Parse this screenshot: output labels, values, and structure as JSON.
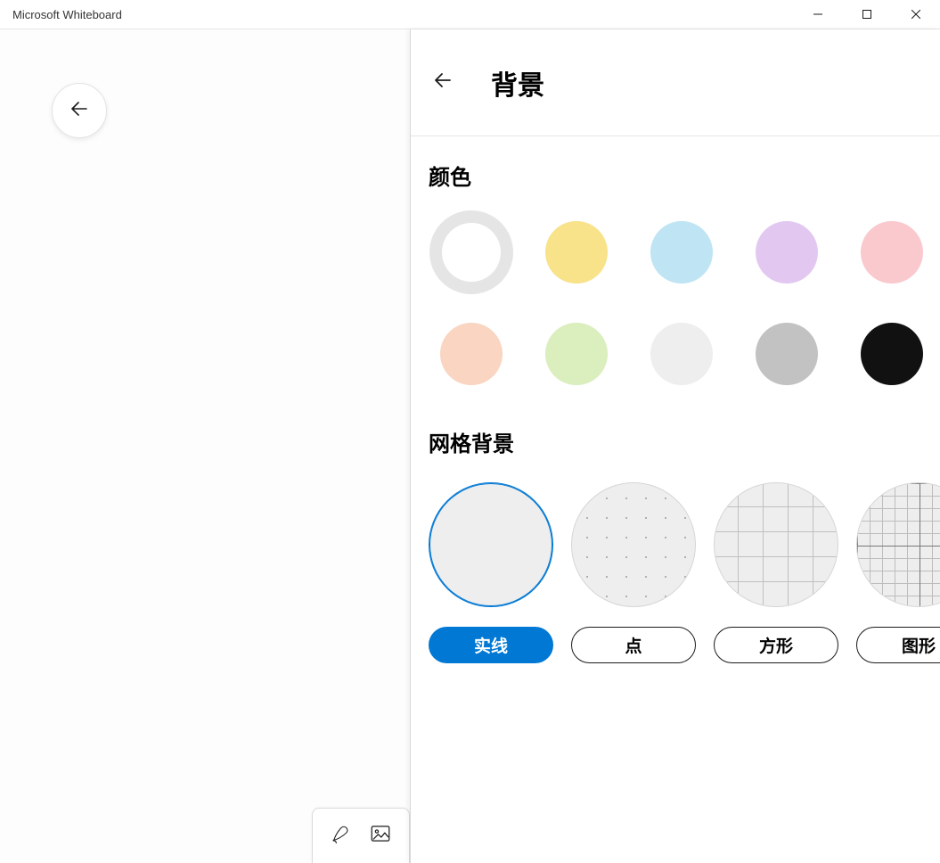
{
  "window": {
    "title": "Microsoft Whiteboard"
  },
  "panel": {
    "title": "背景",
    "color_section_title": "颜色",
    "grid_section_title": "网格背景",
    "colors": [
      {
        "name": "white",
        "hex": "#ffffff",
        "selected": true
      },
      {
        "name": "yellow",
        "hex": "#f8e28a",
        "selected": false
      },
      {
        "name": "blue",
        "hex": "#bfe4f4",
        "selected": false
      },
      {
        "name": "purple",
        "hex": "#e2c8f0",
        "selected": false
      },
      {
        "name": "pink",
        "hex": "#fac9cd",
        "selected": false
      },
      {
        "name": "peach",
        "hex": "#f9d5c2",
        "selected": false
      },
      {
        "name": "green",
        "hex": "#daeebe",
        "selected": false
      },
      {
        "name": "lightgray",
        "hex": "#eeeeee",
        "selected": false
      },
      {
        "name": "gray",
        "hex": "#c2c2c2",
        "selected": false
      },
      {
        "name": "black",
        "hex": "#111111",
        "selected": false
      }
    ],
    "grids": [
      {
        "id": "solid",
        "label": "实线",
        "selected": true
      },
      {
        "id": "dot",
        "label": "点",
        "selected": false
      },
      {
        "id": "square",
        "label": "方形",
        "selected": false
      },
      {
        "id": "shape",
        "label": "图形",
        "selected": false
      }
    ]
  }
}
